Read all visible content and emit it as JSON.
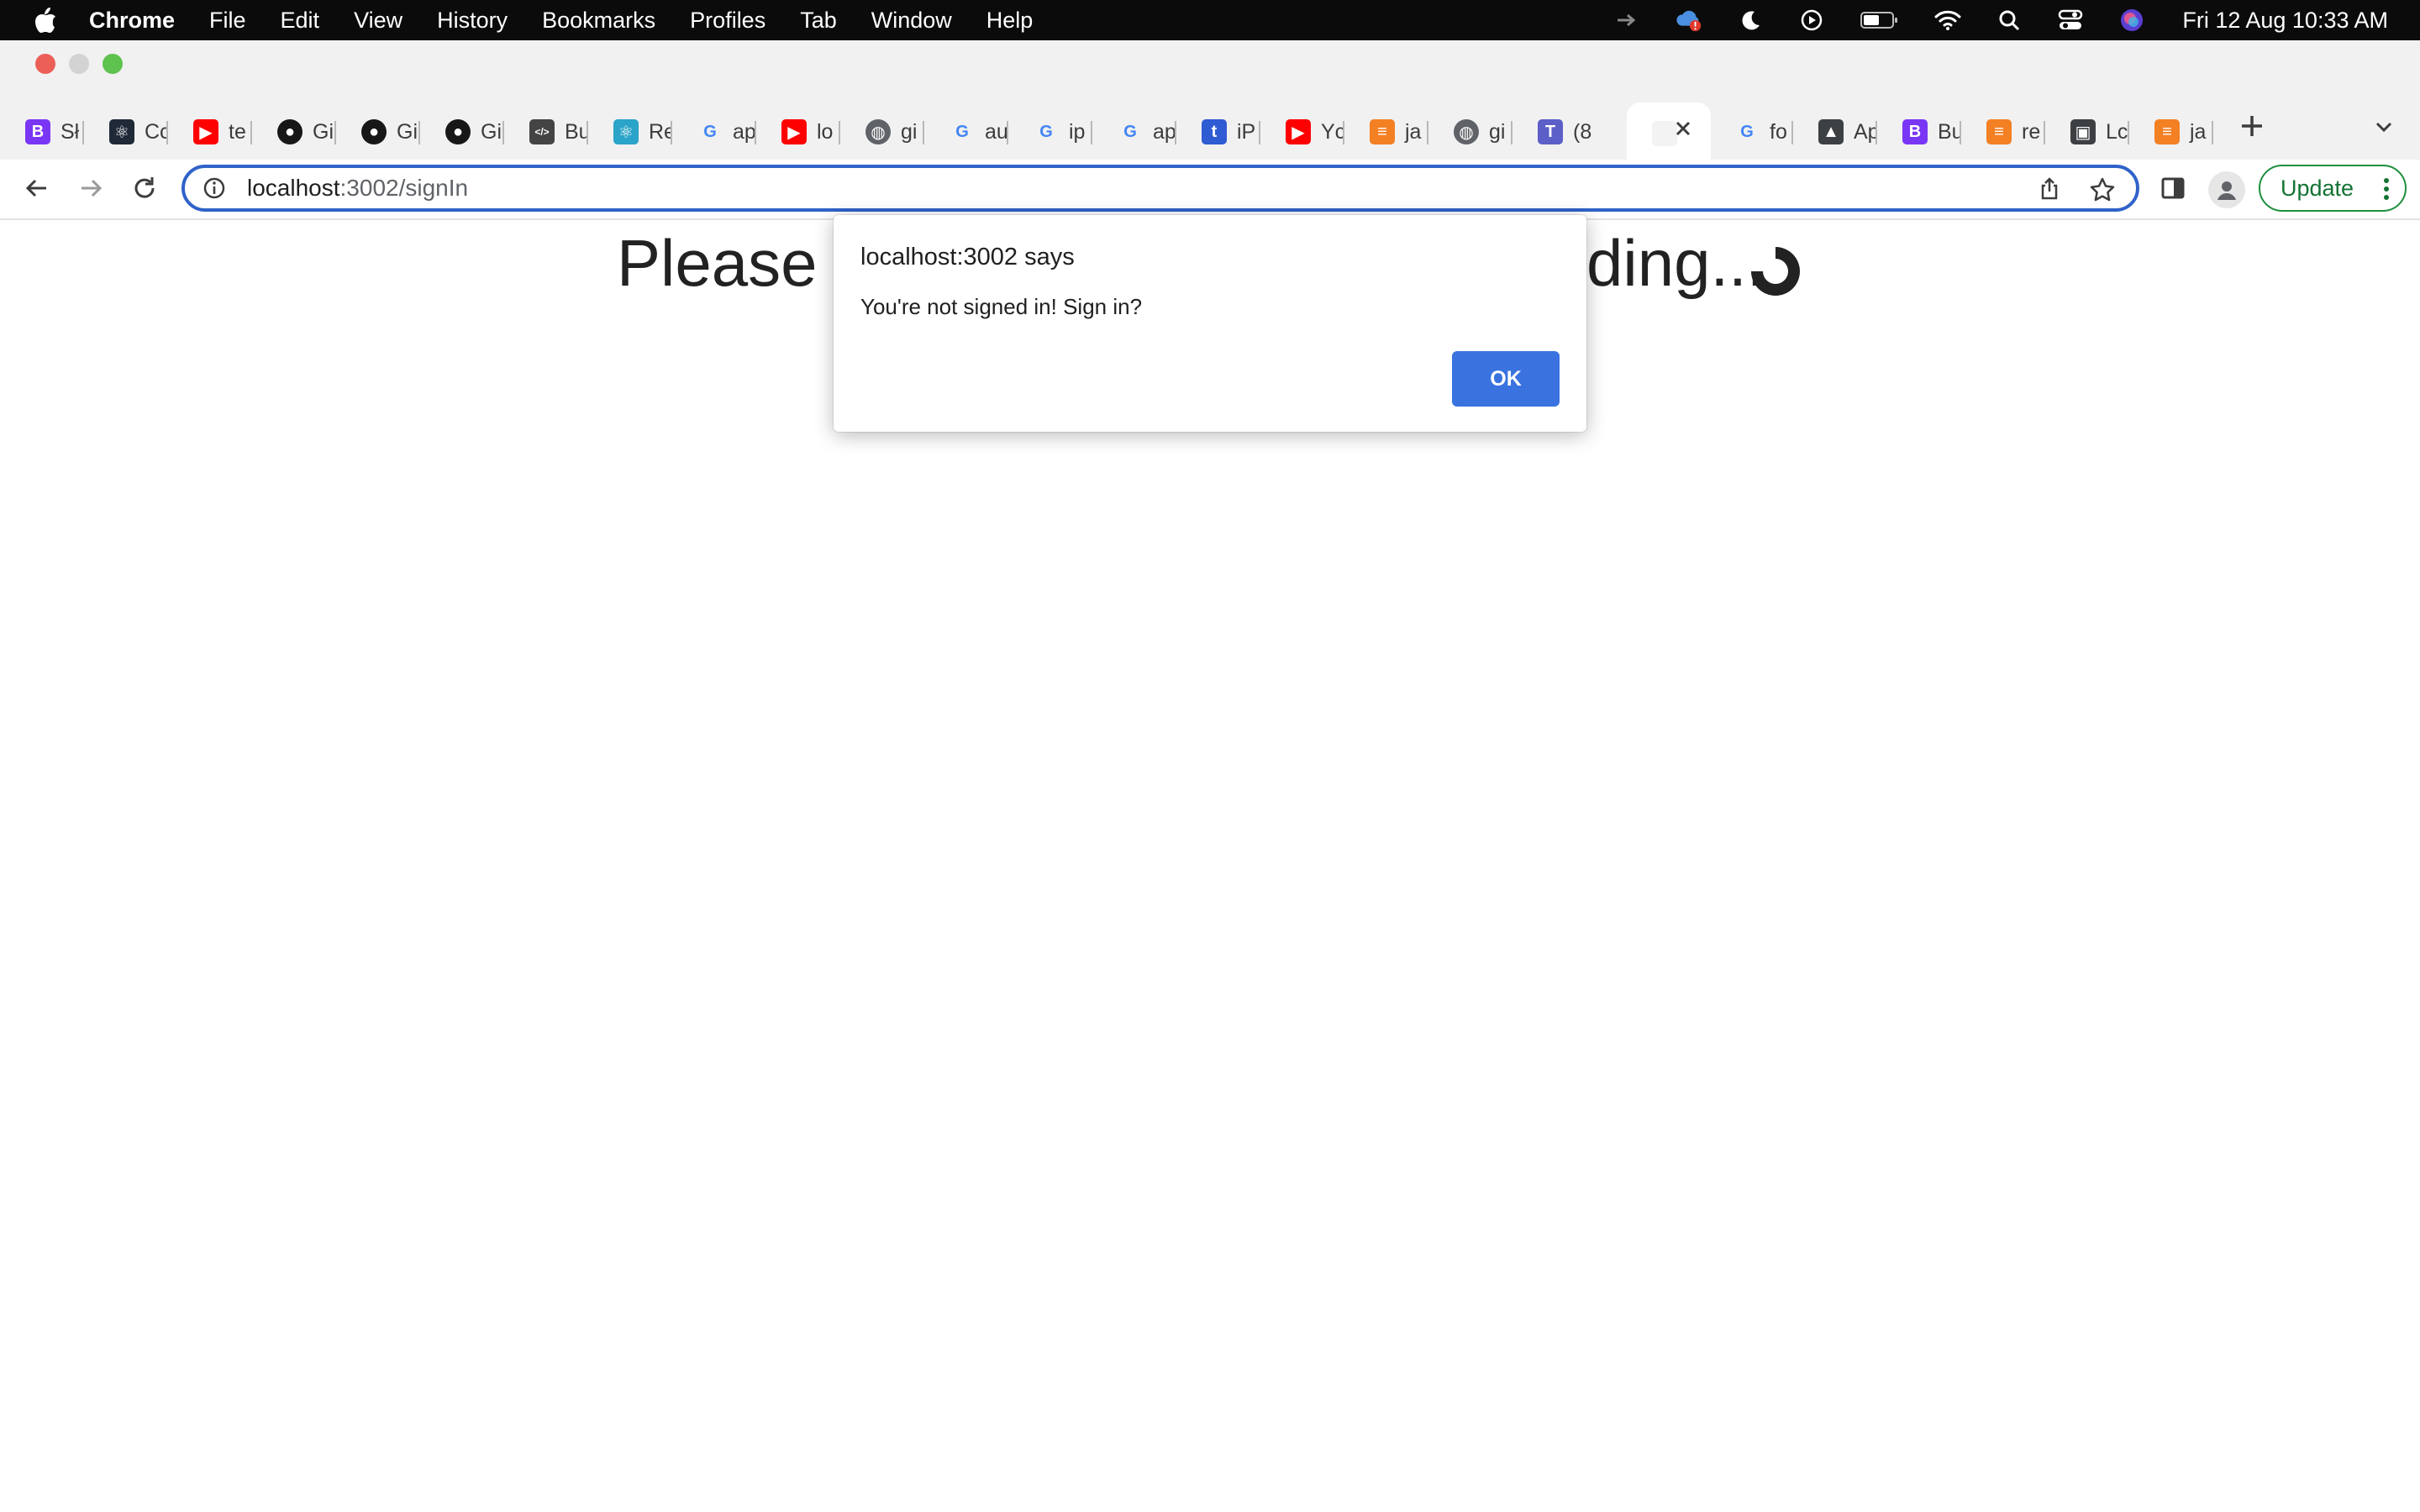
{
  "menubar": {
    "app_name": "Chrome",
    "items": [
      "File",
      "Edit",
      "View",
      "History",
      "Bookmarks",
      "Profiles",
      "Tab",
      "Window",
      "Help"
    ],
    "clock": "Fri 12 Aug  10:33 AM"
  },
  "tabs": [
    {
      "label": "Sł",
      "icon": "bootstrap-icon",
      "color": "#7a36f5"
    },
    {
      "label": "Cc",
      "icon": "react-dark-icon",
      "color": "#1f2937"
    },
    {
      "label": "te",
      "icon": "youtube-icon",
      "color": "#ff0000"
    },
    {
      "label": "Gi",
      "icon": "github-icon",
      "color": "#181717"
    },
    {
      "label": "Gi",
      "icon": "github-icon",
      "color": "#181717"
    },
    {
      "label": "Gi",
      "icon": "github-icon",
      "color": "#181717"
    },
    {
      "label": "Bu",
      "icon": "code-window-icon",
      "color": "#444444"
    },
    {
      "label": "Re",
      "icon": "react-icon",
      "color": "#2aa4c8"
    },
    {
      "label": "ap",
      "icon": "google-icon",
      "color": "#4285f4"
    },
    {
      "label": "lo",
      "icon": "youtube-icon",
      "color": "#ff0000"
    },
    {
      "label": "gi",
      "icon": "globe-icon",
      "color": "#5f6368"
    },
    {
      "label": "au",
      "icon": "google-icon",
      "color": "#4285f4"
    },
    {
      "label": "ip",
      "icon": "google-icon",
      "color": "#4285f4"
    },
    {
      "label": "ap",
      "icon": "google-icon",
      "color": "#4285f4"
    },
    {
      "label": "iP",
      "icon": "tumblr-icon",
      "color": "#2f5bd3"
    },
    {
      "label": "Yc",
      "icon": "youtube-icon",
      "color": "#ff0000"
    },
    {
      "label": "ja",
      "icon": "stackoverflow-icon",
      "color": "#f48024"
    },
    {
      "label": "gi",
      "icon": "globe-icon",
      "color": "#5f6368"
    },
    {
      "label": "(8",
      "icon": "teams-icon",
      "color": "#5b5fc7"
    },
    {
      "label": "",
      "icon": "blank-page-icon",
      "color": "#f3f3f3",
      "active": true
    },
    {
      "label": "fo",
      "icon": "google-icon",
      "color": "#4285f4"
    },
    {
      "label": "Ap",
      "icon": "graduation-cap-icon",
      "color": "#3c4043"
    },
    {
      "label": "Bu",
      "icon": "bootstrap-icon",
      "color": "#7a36f5"
    },
    {
      "label": "re",
      "icon": "stackoverflow-icon",
      "color": "#f48024"
    },
    {
      "label": "Lc",
      "icon": "image-icon",
      "color": "#3c4043"
    },
    {
      "label": "ja",
      "icon": "stackoverflow-icon",
      "color": "#f48024"
    }
  ],
  "address_bar": {
    "host": "localhost",
    "path": ":3002/signIn"
  },
  "toolbar": {
    "update_label": "Update"
  },
  "page": {
    "heading_left": "Please",
    "heading_right": "ding..."
  },
  "dialog": {
    "title": "localhost:3002 says",
    "message": "You're not signed in! Sign in?",
    "ok_label": "OK"
  },
  "colors": {
    "accent": "#2f62c9",
    "ok_button": "#3a73e0",
    "update_green": "#137333"
  }
}
